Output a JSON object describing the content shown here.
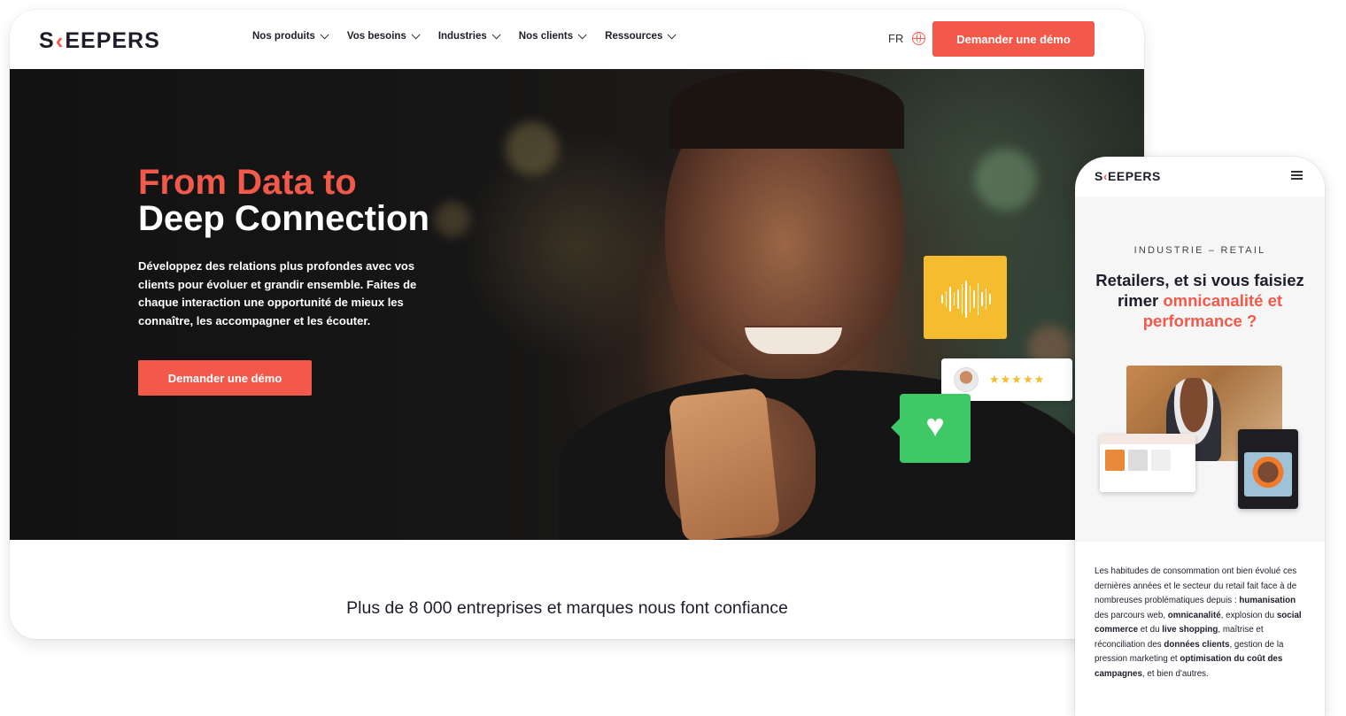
{
  "desktop": {
    "logo": {
      "prefix": "S",
      "accent": "‹",
      "suffix": "EEPERS"
    },
    "nav": [
      {
        "label": "Nos produits"
      },
      {
        "label": "Vos besoins"
      },
      {
        "label": "Industries"
      },
      {
        "label": "Nos clients"
      },
      {
        "label": "Ressources"
      }
    ],
    "lang": "FR",
    "cta_label": "Demander une démo",
    "hero": {
      "title_line1": "From Data to",
      "title_line2": "Deep Connection",
      "text": "Développez des relations plus profondes avec vos clients pour évoluer et grandir ensemble. Faites de chaque interaction une opportunité de mieux les connaître, les accompagner et les écouter.",
      "cta_label": "Demander une démo",
      "stars": "★★★★★",
      "heart": "♥"
    },
    "trust_text": "Plus de 8 000 entreprises et marques nous font confiance"
  },
  "mobile": {
    "logo": {
      "prefix": "S",
      "accent": "‹",
      "suffix": "EEPERS"
    },
    "kicker": "INDUSTRIE – RETAIL",
    "title_part1": "Retailers, et si vous faisiez rimer ",
    "title_highlight": "omnicanalité et performance ?",
    "body": [
      {
        "t": "Les habitudes de consommation ont bien évolué ces dernières années et le secteur du retail fait face à de nombreuses problématiques depuis : ",
        "b": false
      },
      {
        "t": "humanisation",
        "b": true
      },
      {
        "t": " des parcours web, ",
        "b": false
      },
      {
        "t": "omnicanalité",
        "b": true
      },
      {
        "t": ", explosion du ",
        "b": false
      },
      {
        "t": "social commerce",
        "b": true
      },
      {
        "t": " et du ",
        "b": false
      },
      {
        "t": "live shopping",
        "b": true
      },
      {
        "t": ", maîtrise et réconciliation des ",
        "b": false
      },
      {
        "t": "données clients",
        "b": true
      },
      {
        "t": ", gestion de la pression marketing et ",
        "b": false
      },
      {
        "t": "optimisation du coût des campagnes",
        "b": true
      },
      {
        "t": ", et bien d'autres.",
        "b": false
      }
    ]
  },
  "colors": {
    "accent": "#f2594b",
    "yellow": "#f5bc2f",
    "green": "#3ec966",
    "dark": "#1d1d2b"
  },
  "icons": [
    "chevron-down-icon",
    "globe-icon",
    "audio-wave-icon",
    "star-icon",
    "heart-icon",
    "menu-icon"
  ]
}
